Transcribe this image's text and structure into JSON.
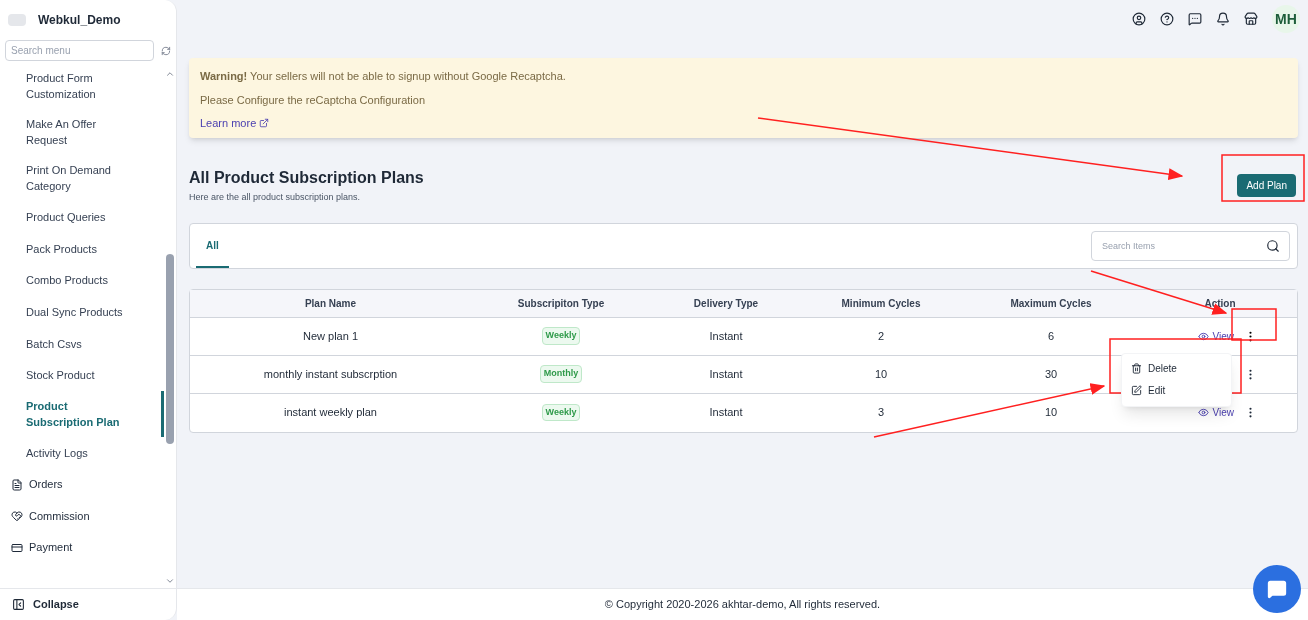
{
  "sidebar": {
    "brand": "Webkul_Demo",
    "search": {
      "placeholder": "Search menu"
    },
    "sub_items": [
      {
        "label": "Product Form Customization",
        "selected": false
      },
      {
        "label": "Make An Offer Request",
        "selected": false
      },
      {
        "label": "Print On Demand Category",
        "selected": false
      },
      {
        "label": "Product Queries",
        "selected": false
      },
      {
        "label": "Pack Products",
        "selected": false
      },
      {
        "label": "Combo Products",
        "selected": false
      },
      {
        "label": "Dual Sync Products",
        "selected": false
      },
      {
        "label": "Batch Csvs",
        "selected": false
      },
      {
        "label": "Stock Product",
        "selected": false
      },
      {
        "label": "Product Subscription Plan",
        "selected": true
      },
      {
        "label": "Activity Logs",
        "selected": false
      }
    ],
    "items": [
      {
        "label": "Orders",
        "kind": "orders"
      },
      {
        "label": "Commission",
        "kind": "commission"
      },
      {
        "label": "Payment",
        "kind": "payment"
      }
    ],
    "collapse": "Collapse"
  },
  "header": {
    "avatar": "MH"
  },
  "alert": {
    "text": "**Warning!** Your sellers will not be able to signup without Google Recaptcha.",
    "detail": "Please Configure the reCaptcha Configuration",
    "link": "Learn more"
  },
  "page": {
    "title": "All Product Subscription Plans",
    "subtitle": "Here are the all product subscription plans.",
    "add_button": "Add Plan"
  },
  "tabs": [
    {
      "label": "All",
      "selected": true
    }
  ],
  "search": {
    "placeholder": "Search Items"
  },
  "table": {
    "columns": [
      "Plan Name",
      "Subscripiton Type",
      "Delivery Type",
      "Minimum Cycles",
      "Maximum Cycles",
      "Action"
    ],
    "rows": [
      {
        "name": "New plan 1",
        "type": "Weekly",
        "delivery": "Instant",
        "min": "2",
        "max": "6",
        "view": "View",
        "menu_open": true
      },
      {
        "name": "monthly instant subscrption",
        "type": "Monthly",
        "delivery": "Instant",
        "min": "10",
        "max": "30",
        "menu_open": false
      },
      {
        "name": "instant weekly plan",
        "type": "Weekly",
        "delivery": "Instant",
        "min": "3",
        "max": "10",
        "view": "View",
        "menu_open": false
      }
    ]
  },
  "row_menu": [
    {
      "label": "Delete",
      "kind": "delete"
    },
    {
      "label": "Edit",
      "kind": "edit"
    }
  ],
  "footer": "© Copyright 2020-2026 akhtar-demo, All rights reserved."
}
